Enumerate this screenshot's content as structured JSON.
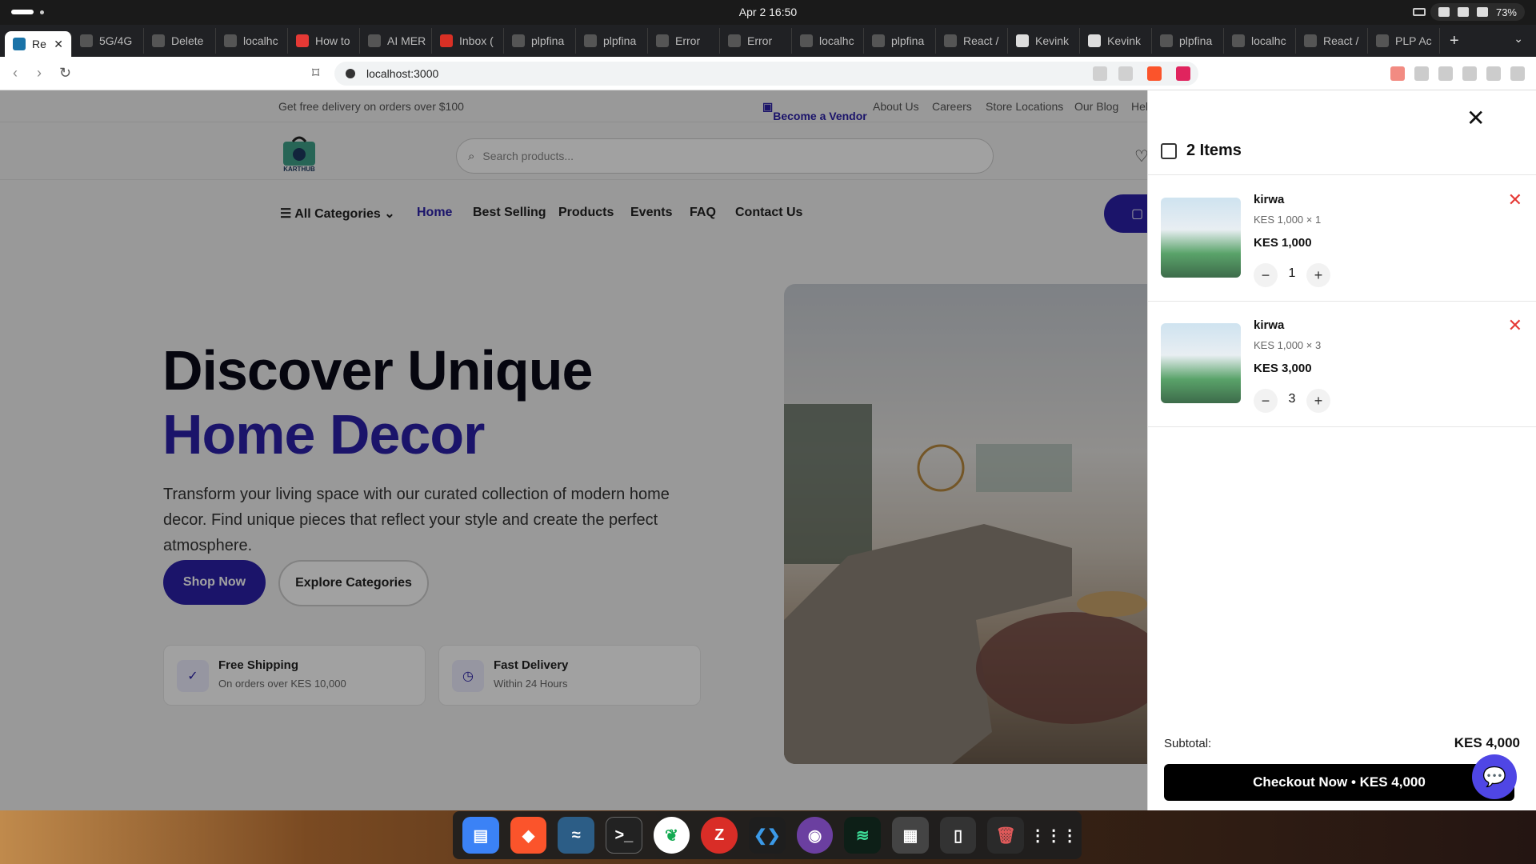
{
  "system": {
    "clock": "Apr 2  16:50",
    "battery": "73%"
  },
  "tabs": [
    {
      "label": "Re",
      "active": true
    },
    {
      "label": "5G/4G"
    },
    {
      "label": "Delete"
    },
    {
      "label": "localhc"
    },
    {
      "label": "How to"
    },
    {
      "label": "AI MER"
    },
    {
      "label": "Inbox ("
    },
    {
      "label": "plpfina"
    },
    {
      "label": "plpfina"
    },
    {
      "label": "Error"
    },
    {
      "label": "Error"
    },
    {
      "label": "localhc"
    },
    {
      "label": "plpfina"
    },
    {
      "label": "React /"
    },
    {
      "label": "Kevink"
    },
    {
      "label": "Kevink"
    },
    {
      "label": "plpfina"
    },
    {
      "label": "localhc"
    },
    {
      "label": "React /"
    },
    {
      "label": "PLP Ac"
    }
  ],
  "address": {
    "url": "localhost:3000"
  },
  "topbar": {
    "promo": "Get free delivery on orders over $100",
    "vendor": "Become a Vendor",
    "about": "About Us",
    "careers": "Careers",
    "stores": "Store Locations",
    "blog": "Our Blog",
    "help": "Hel"
  },
  "header": {
    "logo_text": "KARTHUB",
    "search_placeholder": "Search products..."
  },
  "nav": {
    "categories": "All Categories",
    "items": [
      "Home",
      "Best Selling",
      "Products",
      "Events",
      "FAQ",
      "Contact Us"
    ]
  },
  "hero": {
    "title_line1": "Discover Unique",
    "title_line2": "Home Decor",
    "lead": "Transform your living space with our curated collection of modern home decor. Find unique pieces that reflect your style and create the perfect atmosphere.",
    "shop_now": "Shop Now",
    "explore": "Explore Categories",
    "features": [
      {
        "title": "Free Shipping",
        "subtitle": "On orders over KES 10,000"
      },
      {
        "title": "Fast Delivery",
        "subtitle": "Within 24 Hours"
      }
    ]
  },
  "cart": {
    "count_label": "2 Items",
    "items": [
      {
        "name": "kirwa",
        "unit": "KES 1,000  ×  1",
        "total": "KES 1,000",
        "qty": "1"
      },
      {
        "name": "kirwa",
        "unit": "KES 1,000  ×  3",
        "total": "KES 3,000",
        "qty": "3"
      }
    ],
    "subtotal_label": "Subtotal:",
    "subtotal_value": "KES 4,000",
    "checkout": "Checkout Now • KES 4,000"
  },
  "dock": {
    "apps": [
      "files",
      "brave",
      "mysql-workbench",
      "terminal",
      "mongodb",
      "filezilla",
      "vscode",
      "tor",
      "bolt",
      "text-editor",
      "phone",
      "trash",
      "app-grid"
    ]
  }
}
